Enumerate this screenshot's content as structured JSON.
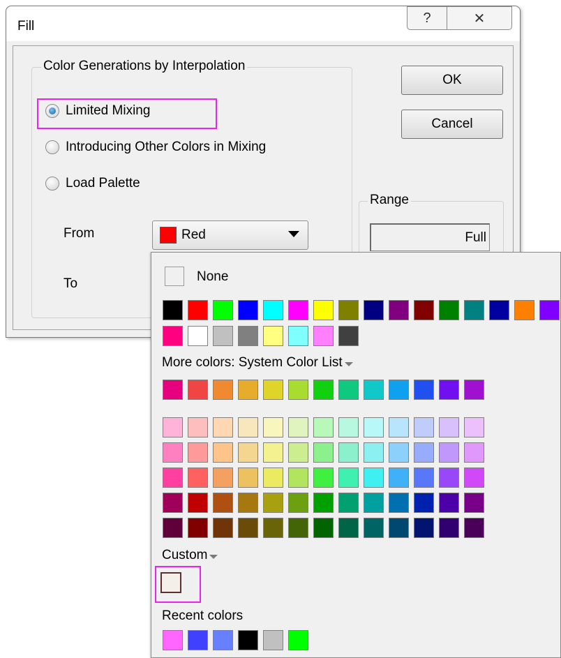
{
  "dialog": {
    "title": "Fill",
    "help_glyph": "?",
    "close_glyph": "✕",
    "group_title": "Color Generations by Interpolation",
    "radio_options": [
      {
        "label": "Limited Mixing",
        "checked": true
      },
      {
        "label": "Introducing Other Colors in Mixing",
        "checked": false
      },
      {
        "label": "Load Palette",
        "checked": false
      }
    ],
    "from_label": "From",
    "to_label": "To",
    "from_combo": {
      "value": "Red",
      "swatch_color": "#ff0000"
    },
    "ok_label": "OK",
    "cancel_label": "Cancel",
    "range_group_title": "Range",
    "range_value": "Full"
  },
  "popup": {
    "none_label": "None",
    "basic_colors": [
      "#000000",
      "#ff0000",
      "#00ff00",
      "#0000ff",
      "#00ffff",
      "#ff00ff",
      "#ffff00",
      "#808000",
      "#000080",
      "#800080",
      "#800000",
      "#008000",
      "#008080",
      "#0000a0",
      "#ff8000",
      "#8000ff",
      "#ff0080",
      "#ffffff",
      "#c0c0c0",
      "#808080",
      "#ffff80",
      "#80ffff",
      "#ff80ff",
      "#404040"
    ],
    "more_colors_label": "More colors: System Color List",
    "system_colors": [
      "#e6007e",
      "#f04545",
      "#f08a30",
      "#e8ac2c",
      "#e0d42a",
      "#a8dc30",
      "#10d010",
      "#10c880",
      "#10c8c8",
      "#10a0f0",
      "#2050f0",
      "#7010f0",
      "#a010d0"
    ],
    "tint_rows": [
      [
        "#ffb3d9",
        "#ffbebe",
        "#ffd8b3",
        "#f8e6bc",
        "#f8f6bc",
        "#e0f4c0",
        "#b8f8b8",
        "#b8f8e0",
        "#b8f8f8",
        "#b8e4fc",
        "#c0ccfc",
        "#d8c0fc",
        "#ecc0fc"
      ],
      [
        "#ff80c0",
        "#ff9a9a",
        "#ffc48a",
        "#f4d690",
        "#f4f290",
        "#ccee90",
        "#8cf08c",
        "#8cf0cc",
        "#8cf0f0",
        "#8cd0fc",
        "#98acfc",
        "#c098fc",
        "#e098fc"
      ],
      [
        "#ff40a0",
        "#ff6060",
        "#f4a060",
        "#ecc260",
        "#ecea60",
        "#b2e460",
        "#40f040",
        "#40f0b0",
        "#40f0f0",
        "#40b0f8",
        "#5878f8",
        "#9848f8",
        "#d048f8"
      ],
      [
        "#a0005a",
        "#c00000",
        "#b05010",
        "#a87810",
        "#a8a010",
        "#6ca010",
        "#00a000",
        "#00a070",
        "#00a0a0",
        "#0070b0",
        "#0020b0",
        "#4c00a8",
        "#780088"
      ],
      [
        "#60003a",
        "#800000",
        "#703408",
        "#6a4c08",
        "#6a6408",
        "#446408",
        "#006400",
        "#006446",
        "#006464",
        "#004870",
        "#001470",
        "#300070",
        "#4a0058"
      ]
    ],
    "custom_label": "Custom",
    "custom_colors": [
      "#f5efe9"
    ],
    "recent_label": "Recent colors",
    "recent_colors": [
      "#ff66ff",
      "#4040ff",
      "#6680ff",
      "#000000",
      "#c0c0c0",
      "#00ff00"
    ]
  }
}
